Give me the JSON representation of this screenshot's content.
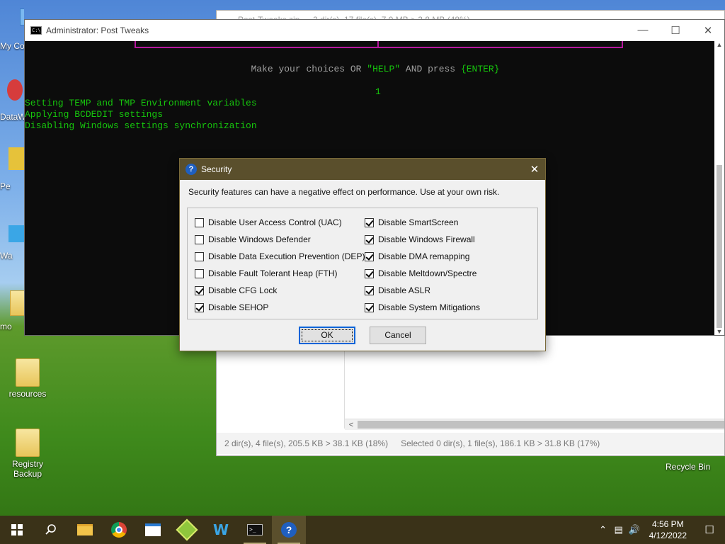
{
  "desktop": {
    "icons": [
      {
        "label": "My Co",
        "kind": "computer"
      },
      {
        "label": "DataW",
        "kind": "app"
      },
      {
        "label": "Pe",
        "kind": "app"
      },
      {
        "label": "Wa",
        "kind": "app"
      },
      {
        "label": "mo",
        "kind": "folder"
      },
      {
        "label": "resources",
        "kind": "folder"
      },
      {
        "label": "Registry Backup",
        "kind": "folder"
      }
    ],
    "recycle_bin_label": "Recycle Bin"
  },
  "file_manager": {
    "title": "Post-Tweaks.zip — 2 dir(s), 17 file(s), 7.9 MB > 3.8 MB (48%)",
    "status_left": "2 dir(s), 4 file(s), 205.5 KB > 38.1 KB (18%)",
    "status_right": "Selected 0 dir(s), 1 file(s), 186.1 KB > 31.8 KB (17%)",
    "scroll_left_icon": "chevron-left-icon"
  },
  "console": {
    "title": "Administrator:  Post Tweaks",
    "controls": {
      "minimize": "—",
      "maximize": "☐",
      "close": "✕"
    },
    "prompt_before": "Make your choices OR ",
    "prompt_help": "\"HELP\"",
    "prompt_mid": " AND press ",
    "prompt_enter": "{ENTER}",
    "choice_entered": "1",
    "log_lines": [
      "Setting TEMP and TMP Environment variables",
      "Applying BCDEDIT settings",
      "Disabling Windows settings synchronization"
    ]
  },
  "dialog": {
    "title": "Security",
    "icon": "question-icon",
    "close_label": "✕",
    "description": "Security features can have a negative effect on performance. Use at your own risk.",
    "left_options": [
      {
        "label": "Disable User Access Control (UAC)",
        "checked": false
      },
      {
        "label": "Disable Windows Defender",
        "checked": false
      },
      {
        "label": "Disable Data Execution Prevention (DEP)",
        "checked": false
      },
      {
        "label": "Disable Fault Tolerant Heap (FTH)",
        "checked": false
      },
      {
        "label": "Disable CFG Lock",
        "checked": true
      },
      {
        "label": "Disable SEHOP",
        "checked": true
      }
    ],
    "right_options": [
      {
        "label": "Disable SmartScreen",
        "checked": true
      },
      {
        "label": "Disable Windows Firewall",
        "checked": true
      },
      {
        "label": "Disable DMA remapping",
        "checked": true
      },
      {
        "label": "Disable Meltdown/Spectre",
        "checked": true
      },
      {
        "label": "Disable ASLR",
        "checked": true
      },
      {
        "label": "Disable System Mitigations",
        "checked": true
      }
    ],
    "ok_label": "OK",
    "cancel_label": "Cancel"
  },
  "taskbar": {
    "items": [
      {
        "name": "start-button",
        "icon": "windows-icon"
      },
      {
        "name": "search-button",
        "icon": "search-icon"
      },
      {
        "name": "file-explorer-button",
        "icon": "folder-icon"
      },
      {
        "name": "chrome-button",
        "icon": "chrome-icon"
      },
      {
        "name": "window-app-button",
        "icon": "window-icon"
      },
      {
        "name": "archiver-button",
        "icon": "archiver-icon"
      },
      {
        "name": "w-app-button",
        "icon": "w-icon"
      },
      {
        "name": "console-button",
        "icon": "console-icon"
      },
      {
        "name": "security-dialog-button",
        "icon": "question-icon"
      }
    ],
    "time": "4:56 PM",
    "date": "4/12/2022"
  },
  "colors": {
    "console_green": "#16c60c",
    "console_magenta": "#b5179e",
    "dialog_title_bg": "#5a4f2c",
    "taskbar_bg": "#3a3218",
    "accent_blue": "#0a64d8"
  }
}
